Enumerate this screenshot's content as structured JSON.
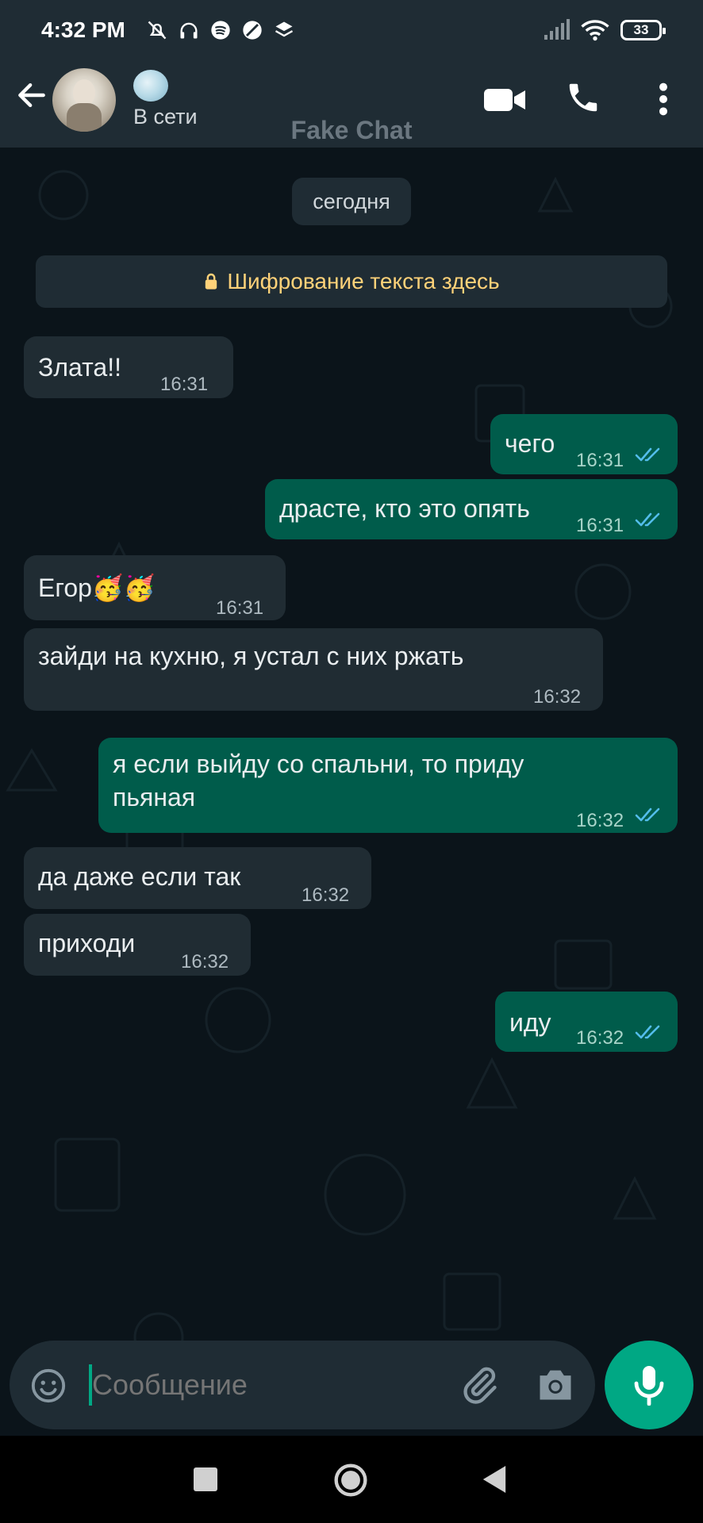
{
  "status_bar": {
    "time": "4:32 PM",
    "battery": "33"
  },
  "header": {
    "contact_status": "В сети",
    "watermark": "Fake Chat"
  },
  "chat": {
    "date_label": "сегодня",
    "encryption_notice": "Шифрование текста здесь",
    "messages": [
      {
        "dir": "in",
        "text": "Злата!!",
        "time": "16:31"
      },
      {
        "dir": "out",
        "text": "чего",
        "time": "16:31",
        "read": true
      },
      {
        "dir": "out",
        "text": "драсте, кто это опять",
        "time": "16:31",
        "read": true
      },
      {
        "dir": "in",
        "text": "Егор🥳🥳",
        "time": "16:31"
      },
      {
        "dir": "in",
        "text": "зайди на кухню, я устал с них ржать",
        "time": "16:32"
      },
      {
        "dir": "out",
        "text": "я если выйду со спальни, то приду пьяная",
        "time": "16:32",
        "read": true
      },
      {
        "dir": "in",
        "text": "да даже если так",
        "time": "16:32"
      },
      {
        "dir": "in",
        "text": "приходи",
        "time": "16:32"
      },
      {
        "dir": "out",
        "text": "иду",
        "time": "16:32",
        "read": true
      }
    ]
  },
  "composer": {
    "placeholder": "Сообщение"
  },
  "colors": {
    "background": "#0b141a",
    "header": "#1f2c34",
    "incoming_bubble": "#202c33",
    "outgoing_bubble": "#005c4b",
    "accent": "#00a884",
    "encryption_text": "#ffd279",
    "read_ticks": "#53bdeb"
  },
  "icons": {
    "status_bar": [
      "bell-off-icon",
      "headphones-icon",
      "spotify-icon",
      "circle-slash-icon",
      "layers-icon",
      "signal-icon",
      "wifi-icon",
      "battery-icon"
    ],
    "header": [
      "back-arrow-icon",
      "video-call-icon",
      "phone-icon",
      "more-vertical-icon"
    ],
    "composer": [
      "emoji-icon",
      "attach-icon",
      "camera-icon",
      "mic-icon"
    ],
    "nav": [
      "nav-square-icon",
      "nav-home-icon",
      "nav-back-icon"
    ]
  }
}
